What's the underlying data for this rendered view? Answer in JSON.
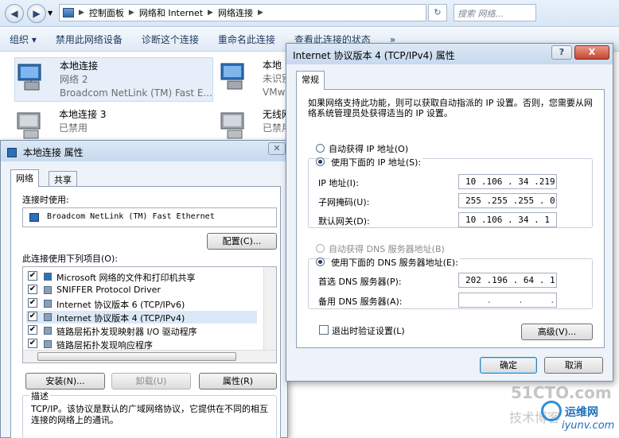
{
  "explorer": {
    "breadcrumb": [
      "控制面板",
      "网络和 Internet",
      "网络连接"
    ],
    "search_placeholder": "搜索 网络...",
    "toolbar": [
      "组织 ▾",
      "禁用此网络设备",
      "诊断这个连接",
      "重命名此连接",
      "查看此连接的状态",
      "»"
    ],
    "items": [
      {
        "name": "本地连接",
        "line2": "网络  2",
        "line3": "Broadcom NetLink (TM) Fast E..."
      },
      {
        "name": "本地",
        "line2": "未识别",
        "line3": "VMw"
      },
      {
        "name": "本地连接 3",
        "line2": "已禁用",
        "line3": ""
      },
      {
        "name": "无线网",
        "line2": "已禁用",
        "line3": ""
      }
    ]
  },
  "props": {
    "title": "本地连接 属性",
    "tabs": [
      "网络",
      "共享"
    ],
    "connect_using_label": "连接时使用:",
    "adapter": "Broadcom NetLink (TM) Fast Ethernet",
    "configure_button": "配置(C)...",
    "items_label": "此连接使用下列项目(O):",
    "components": [
      {
        "label": "Microsoft 网络的文件和打印机共享",
        "checked": true
      },
      {
        "label": "SNIFFER Protocol Driver",
        "checked": true
      },
      {
        "label": "Internet 协议版本 6 (TCP/IPv6)",
        "checked": true
      },
      {
        "label": "Internet 协议版本 4 (TCP/IPv4)",
        "checked": true
      },
      {
        "label": "链路层拓扑发现映射器 I/O 驱动程序",
        "checked": true
      },
      {
        "label": "链路层拓扑发现响应程序",
        "checked": true
      }
    ],
    "install_button": "安装(N)...",
    "uninstall_button": "卸载(U)",
    "properties_button": "属性(R)",
    "description_label": "描述",
    "description": "TCP/IP。该协议是默认的广域网络协议，它提供在不同的相互连接的网络上的通讯。"
  },
  "ipv4": {
    "title": "Internet 协议版本 4 (TCP/IPv4) 属性",
    "help_glyph": "?",
    "close_glyph": "X",
    "tab": "常规",
    "intro": "如果网络支持此功能，则可以获取自动指派的 IP 设置。否则，您需要从网络系统管理员处获得适当的 IP 设置。",
    "auto_ip": "自动获得 IP 地址(O)",
    "manual_ip": "使用下面的 IP 地址(S):",
    "ip_label": "IP 地址(I):",
    "ip_value": "10 .106 . 34 .219",
    "mask_label": "子网掩码(U):",
    "mask_value": "255 .255 .255 . 0",
    "gateway_label": "默认网关(D):",
    "gateway_value": "10 .106 . 34 . 1",
    "auto_dns": "自动获得 DNS 服务器地址(B)",
    "manual_dns": "使用下面的 DNS 服务器地址(E):",
    "pref_dns_label": "首选 DNS 服务器(P):",
    "pref_dns_value": "202 .196 . 64 . 1",
    "alt_dns_label": "备用 DNS 服务器(A):",
    "alt_dns_value": "    .     .     .",
    "validate_label": "退出时验证设置(L)",
    "advanced_button": "高级(V)...",
    "ok_button": "确定",
    "cancel_button": "取消"
  },
  "watermark": {
    "line1": "51CTO.com",
    "line2": "技术博客",
    "brand": "运维网",
    "site": "iyunv.com"
  }
}
